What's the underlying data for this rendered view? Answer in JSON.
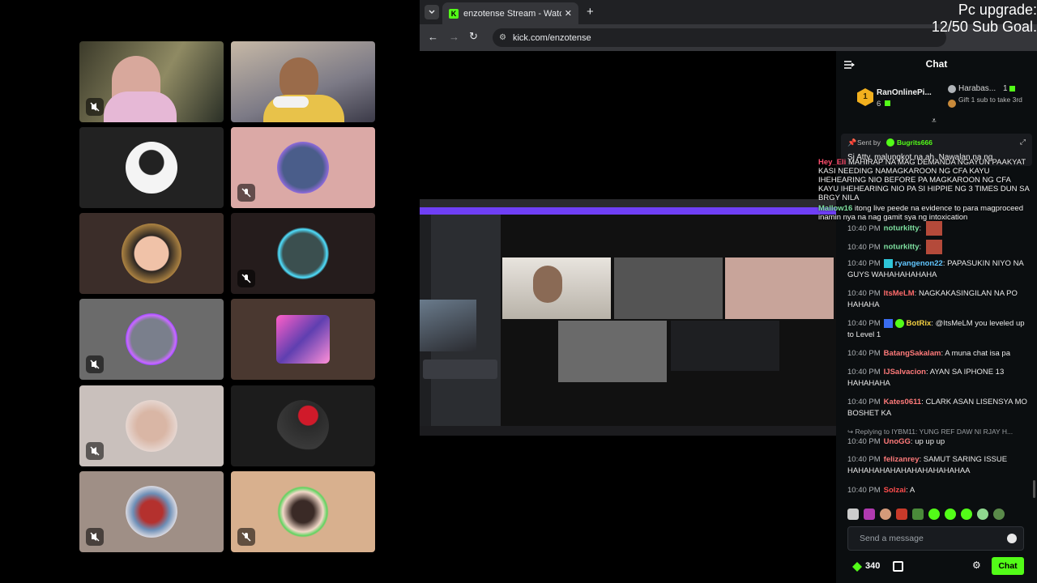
{
  "overlay": {
    "line1": "Pc upgrade:",
    "line2": "12/50 Sub Goal."
  },
  "browser": {
    "tab_title": "enzotense Stream - Watch Live",
    "url": "kick.com/enzotense"
  },
  "chat": {
    "title": "Chat",
    "leaderboard": {
      "first_name": "RanOnlinePi...",
      "first_count": "6",
      "first_rank": "1",
      "second_name": "Harabas...",
      "second_count": "1",
      "second_caption": "Gift 1 sub to take 3rd"
    },
    "pinned": {
      "sent_by_label": "Sent by",
      "sender": "Bugrits666",
      "message": "Si Atty. malungkot na ah. Nawalan na ng"
    },
    "overlay_texts": [
      {
        "user": "Hey_Eli",
        "text": "MAHIRAP NA MAG DEMANDA NGAYUN PAAKYAT KASI NEEDING NAMAGKAROON NG CFA KAYU IHEHEARING NIO BEFORE PA MAGKAROON NG CFA KAYU IHEHEARING NIO PA SI HIPPIE NG 3 TIMES DUN SA BRGY NILA"
      },
      {
        "user": "Mallow16",
        "text": "itong live peede na evidence to para magproceed inamin nya na nag gamit sya ng intoxication"
      }
    ],
    "messages": [
      {
        "time": "10:40 PM",
        "user": "noturkitty",
        "color": "#7ee0a0",
        "text": ""
      },
      {
        "time": "10:40 PM",
        "user": "noturkitty",
        "color": "#7ee0a0",
        "text": ""
      },
      {
        "time": "10:40 PM",
        "user": "ryangenon22",
        "color": "#61c6ff",
        "text": "PAPASUKIN NIYO NA GUYS WAHAHAHAHAHA"
      },
      {
        "time": "10:40 PM",
        "user": "ItsMeLM",
        "color": "#ff6b6b",
        "text": "NAGKAKASINGILAN NA PO HAHAHA"
      },
      {
        "time": "10:40 PM",
        "user": "BotRix",
        "color": "#f5d142",
        "text": "@ItsMeLM you leveled up to Level 1"
      },
      {
        "time": "10:40 PM",
        "user": "BatangSakalam",
        "color": "#ff7a7a",
        "text": "A muna chat isa pa"
      },
      {
        "time": "10:40 PM",
        "user": "IJSalvacion",
        "color": "#ff7a7a",
        "text": "AYAN SA IPHONE 13 HAHAHAHA"
      },
      {
        "time": "10:40 PM",
        "user": "Kates0611",
        "color": "#ff7a7a",
        "text": "CLARK ASAN LISENSYA MO BOSHET KA"
      },
      {
        "time": "10:40 PM",
        "user": "UnoGG",
        "color": "#ff7a7a",
        "text": "up up up"
      },
      {
        "time": "10:40 PM",
        "user": "felizanrey",
        "color": "#ff7a7a",
        "text": "SAMUT SARING ISSUE HAHAHAHAHAHAHAHAHAHAHAA"
      },
      {
        "time": "10:40 PM",
        "user": "Solzai",
        "color": "#ff4d4d",
        "text": "A"
      }
    ],
    "reply_context": "Replying to IYBM11: YUNG REF DAW NI RJAY H...",
    "input_placeholder": "Send a message",
    "points": "340",
    "send_label": "Chat"
  }
}
